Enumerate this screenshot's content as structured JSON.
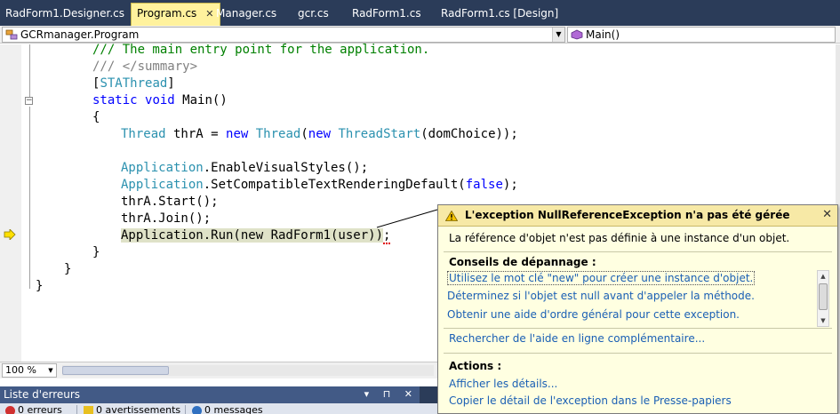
{
  "tabs": [
    {
      "label": "RadForm1.Designer.cs",
      "active": false
    },
    {
      "label": "Program.cs",
      "active": true
    },
    {
      "label": "Manager.cs",
      "active": false
    },
    {
      "label": "gcr.cs",
      "active": false
    },
    {
      "label": "RadForm1.cs",
      "active": false
    },
    {
      "label": "RadForm1.cs [Design]",
      "active": false
    }
  ],
  "tab_close_glyph": "✕",
  "navbar": {
    "class_combo": "GCRmanager.Program",
    "member_combo": "Main()"
  },
  "code": {
    "line1": "/// The main entry point for the application.",
    "line2": "/// </summary>",
    "line3_attr": "STAThread",
    "line4_static": "static",
    "line4_void": "void",
    "line4_main": "Main()",
    "brace_open": "{",
    "line6_type": "Thread",
    "line6_var": " thrA = ",
    "line6_new": "new",
    "line6_ctor": "Thread",
    "line6_paren": "(",
    "line6_new2": "new",
    "line6_ts": "ThreadStart",
    "line6_arg": "(domChoice));",
    "line8_app": "Application",
    "line8_call": ".EnableVisualStyles();",
    "line9_app": "Application",
    "line9_call": ".SetCompatibleTextRenderingDefault(",
    "line9_false": "false",
    "line9_end": ");",
    "line10": "thrA.Start();",
    "line11": "thrA.Join();",
    "line12_hl": "Application.Run(new RadForm1(user))",
    "line12_end": ";",
    "brace_close": "}",
    "brace_close2": "}",
    "brace_close3": "}"
  },
  "zoom": "100 %",
  "error_panel": {
    "title": "Liste d'erreurs",
    "btns": "▾ ⊓ ✕",
    "errors": "0 erreurs",
    "warnings": "0 avertissements",
    "messages": "0 messages"
  },
  "popup": {
    "title": "L'exception NullReferenceException n'a pas été gérée",
    "close": "✕",
    "message": "La référence d'objet n'est pas définie à une instance d'un objet.",
    "tips_heading": "Conseils de dépannage :",
    "tips": [
      "Utilisez le mot clé \"new\" pour créer une instance d'objet.",
      "Déterminez si l'objet est null avant d'appeler la méthode.",
      "Obtenir une aide d'ordre général pour cette exception."
    ],
    "search_link": "Rechercher de l'aide en ligne complémentaire...",
    "actions_heading": "Actions :",
    "actions": [
      "Afficher les détails...",
      "Copier le détail de l'exception dans le Presse-papiers"
    ]
  },
  "colors": {
    "tab_bar": "#2b3c59",
    "active_tab": "#fff29d",
    "keyword": "#0000ff",
    "comment": "#008000",
    "type": "#2b91af",
    "popup_bg": "#ffffe1",
    "link": "#1a5fb4"
  }
}
